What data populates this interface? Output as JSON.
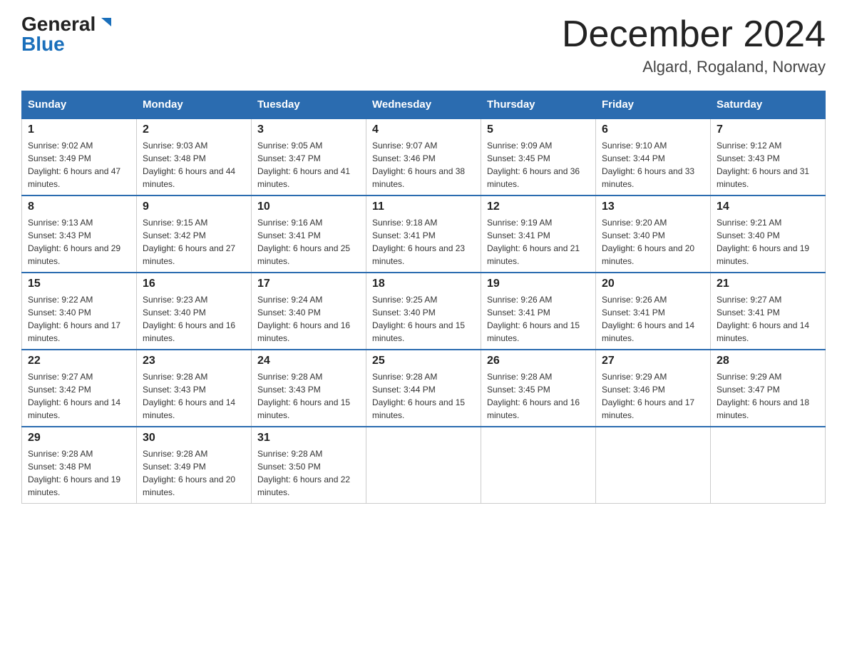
{
  "logo": {
    "general": "General",
    "blue": "Blue"
  },
  "title": {
    "month_year": "December 2024",
    "location": "Algard, Rogaland, Norway"
  },
  "weekdays": [
    "Sunday",
    "Monday",
    "Tuesday",
    "Wednesday",
    "Thursday",
    "Friday",
    "Saturday"
  ],
  "weeks": [
    [
      {
        "day": "1",
        "sunrise": "9:02 AM",
        "sunset": "3:49 PM",
        "daylight": "6 hours and 47 minutes."
      },
      {
        "day": "2",
        "sunrise": "9:03 AM",
        "sunset": "3:48 PM",
        "daylight": "6 hours and 44 minutes."
      },
      {
        "day": "3",
        "sunrise": "9:05 AM",
        "sunset": "3:47 PM",
        "daylight": "6 hours and 41 minutes."
      },
      {
        "day": "4",
        "sunrise": "9:07 AM",
        "sunset": "3:46 PM",
        "daylight": "6 hours and 38 minutes."
      },
      {
        "day": "5",
        "sunrise": "9:09 AM",
        "sunset": "3:45 PM",
        "daylight": "6 hours and 36 minutes."
      },
      {
        "day": "6",
        "sunrise": "9:10 AM",
        "sunset": "3:44 PM",
        "daylight": "6 hours and 33 minutes."
      },
      {
        "day": "7",
        "sunrise": "9:12 AM",
        "sunset": "3:43 PM",
        "daylight": "6 hours and 31 minutes."
      }
    ],
    [
      {
        "day": "8",
        "sunrise": "9:13 AM",
        "sunset": "3:43 PM",
        "daylight": "6 hours and 29 minutes."
      },
      {
        "day": "9",
        "sunrise": "9:15 AM",
        "sunset": "3:42 PM",
        "daylight": "6 hours and 27 minutes."
      },
      {
        "day": "10",
        "sunrise": "9:16 AM",
        "sunset": "3:41 PM",
        "daylight": "6 hours and 25 minutes."
      },
      {
        "day": "11",
        "sunrise": "9:18 AM",
        "sunset": "3:41 PM",
        "daylight": "6 hours and 23 minutes."
      },
      {
        "day": "12",
        "sunrise": "9:19 AM",
        "sunset": "3:41 PM",
        "daylight": "6 hours and 21 minutes."
      },
      {
        "day": "13",
        "sunrise": "9:20 AM",
        "sunset": "3:40 PM",
        "daylight": "6 hours and 20 minutes."
      },
      {
        "day": "14",
        "sunrise": "9:21 AM",
        "sunset": "3:40 PM",
        "daylight": "6 hours and 19 minutes."
      }
    ],
    [
      {
        "day": "15",
        "sunrise": "9:22 AM",
        "sunset": "3:40 PM",
        "daylight": "6 hours and 17 minutes."
      },
      {
        "day": "16",
        "sunrise": "9:23 AM",
        "sunset": "3:40 PM",
        "daylight": "6 hours and 16 minutes."
      },
      {
        "day": "17",
        "sunrise": "9:24 AM",
        "sunset": "3:40 PM",
        "daylight": "6 hours and 16 minutes."
      },
      {
        "day": "18",
        "sunrise": "9:25 AM",
        "sunset": "3:40 PM",
        "daylight": "6 hours and 15 minutes."
      },
      {
        "day": "19",
        "sunrise": "9:26 AM",
        "sunset": "3:41 PM",
        "daylight": "6 hours and 15 minutes."
      },
      {
        "day": "20",
        "sunrise": "9:26 AM",
        "sunset": "3:41 PM",
        "daylight": "6 hours and 14 minutes."
      },
      {
        "day": "21",
        "sunrise": "9:27 AM",
        "sunset": "3:41 PM",
        "daylight": "6 hours and 14 minutes."
      }
    ],
    [
      {
        "day": "22",
        "sunrise": "9:27 AM",
        "sunset": "3:42 PM",
        "daylight": "6 hours and 14 minutes."
      },
      {
        "day": "23",
        "sunrise": "9:28 AM",
        "sunset": "3:43 PM",
        "daylight": "6 hours and 14 minutes."
      },
      {
        "day": "24",
        "sunrise": "9:28 AM",
        "sunset": "3:43 PM",
        "daylight": "6 hours and 15 minutes."
      },
      {
        "day": "25",
        "sunrise": "9:28 AM",
        "sunset": "3:44 PM",
        "daylight": "6 hours and 15 minutes."
      },
      {
        "day": "26",
        "sunrise": "9:28 AM",
        "sunset": "3:45 PM",
        "daylight": "6 hours and 16 minutes."
      },
      {
        "day": "27",
        "sunrise": "9:29 AM",
        "sunset": "3:46 PM",
        "daylight": "6 hours and 17 minutes."
      },
      {
        "day": "28",
        "sunrise": "9:29 AM",
        "sunset": "3:47 PM",
        "daylight": "6 hours and 18 minutes."
      }
    ],
    [
      {
        "day": "29",
        "sunrise": "9:28 AM",
        "sunset": "3:48 PM",
        "daylight": "6 hours and 19 minutes."
      },
      {
        "day": "30",
        "sunrise": "9:28 AM",
        "sunset": "3:49 PM",
        "daylight": "6 hours and 20 minutes."
      },
      {
        "day": "31",
        "sunrise": "9:28 AM",
        "sunset": "3:50 PM",
        "daylight": "6 hours and 22 minutes."
      },
      null,
      null,
      null,
      null
    ]
  ]
}
